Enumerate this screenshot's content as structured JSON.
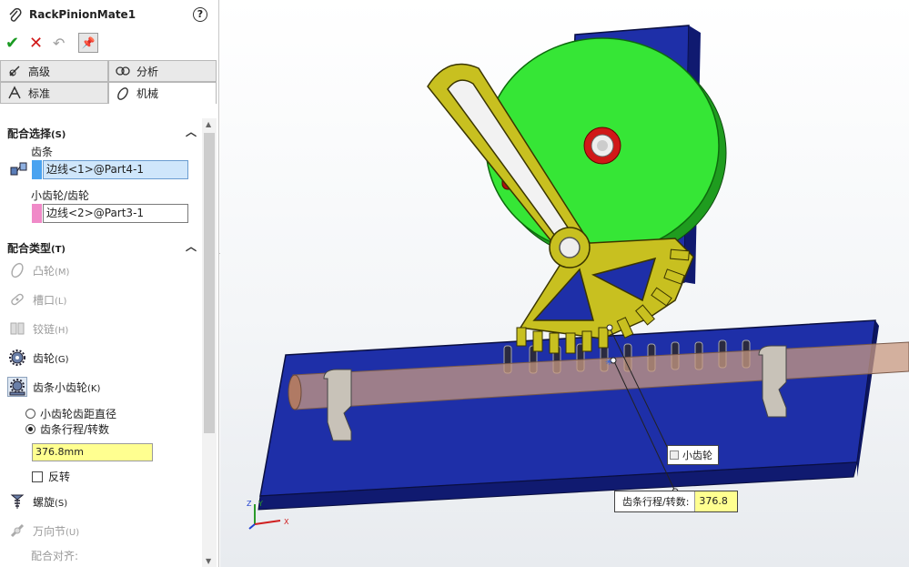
{
  "panel": {
    "title": "RackPinionMate1",
    "help_label": "?",
    "tabs": [
      {
        "label": "高级",
        "icon": "advanced-icon"
      },
      {
        "label": "分析",
        "icon": "analysis-icon"
      },
      {
        "label": "标准",
        "icon": "standard-icon"
      },
      {
        "label": "机械",
        "icon": "mechanical-icon"
      }
    ],
    "active_tab": "机械",
    "mate_selections": {
      "header": "配合选择",
      "header_hotkey": "(S)",
      "rack_label": "齿条",
      "rack_value": "边线<1>@Part4-1",
      "rack_color": "#4aa3f0",
      "pinion_label": "小齿轮/齿轮",
      "pinion_value": "边线<2>@Part3-1",
      "pinion_color": "#f08ac8"
    },
    "mate_types": {
      "header": "配合类型",
      "header_hotkey": "(T)",
      "items": [
        {
          "label": "凸轮",
          "hotkey": "(M)",
          "icon": "cam-icon",
          "enabled": false
        },
        {
          "label": "槽口",
          "hotkey": "(L)",
          "icon": "slot-icon",
          "enabled": false
        },
        {
          "label": "铰链",
          "hotkey": "(H)",
          "icon": "hinge-icon",
          "enabled": false
        },
        {
          "label": "齿轮",
          "hotkey": "(G)",
          "icon": "gear-icon",
          "enabled": true
        },
        {
          "label": "齿条小齿轮",
          "hotkey": "(K)",
          "icon": "rack-pinion-icon",
          "enabled": true,
          "selected": true
        }
      ],
      "option_pitch": "小齿轮齿距直径",
      "option_travel": "齿条行程/转数",
      "option_selected": "齿条行程/转数",
      "travel_value": "376.8mm",
      "reverse_label": "反转",
      "reverse_checked": false,
      "more_items": [
        {
          "label": "螺旋",
          "hotkey": "(S)",
          "icon": "screw-icon",
          "enabled": true
        },
        {
          "label": "万向节",
          "hotkey": "(U)",
          "icon": "universal-joint-icon",
          "enabled": false
        }
      ],
      "alignment_label": "配合对齐:"
    }
  },
  "viewport": {
    "callout_pinion": "小齿轮",
    "callout_travel_label": "齿条行程/转数:",
    "callout_travel_value": "376.8",
    "triad": {
      "x": "X",
      "y": "Y",
      "z": "Z"
    },
    "colors": {
      "plate": "#1e2fa8",
      "gear_disk": "#36e636",
      "arm": "#c8c020",
      "rod": "#c89a80",
      "red_pin": "#d01818"
    }
  }
}
